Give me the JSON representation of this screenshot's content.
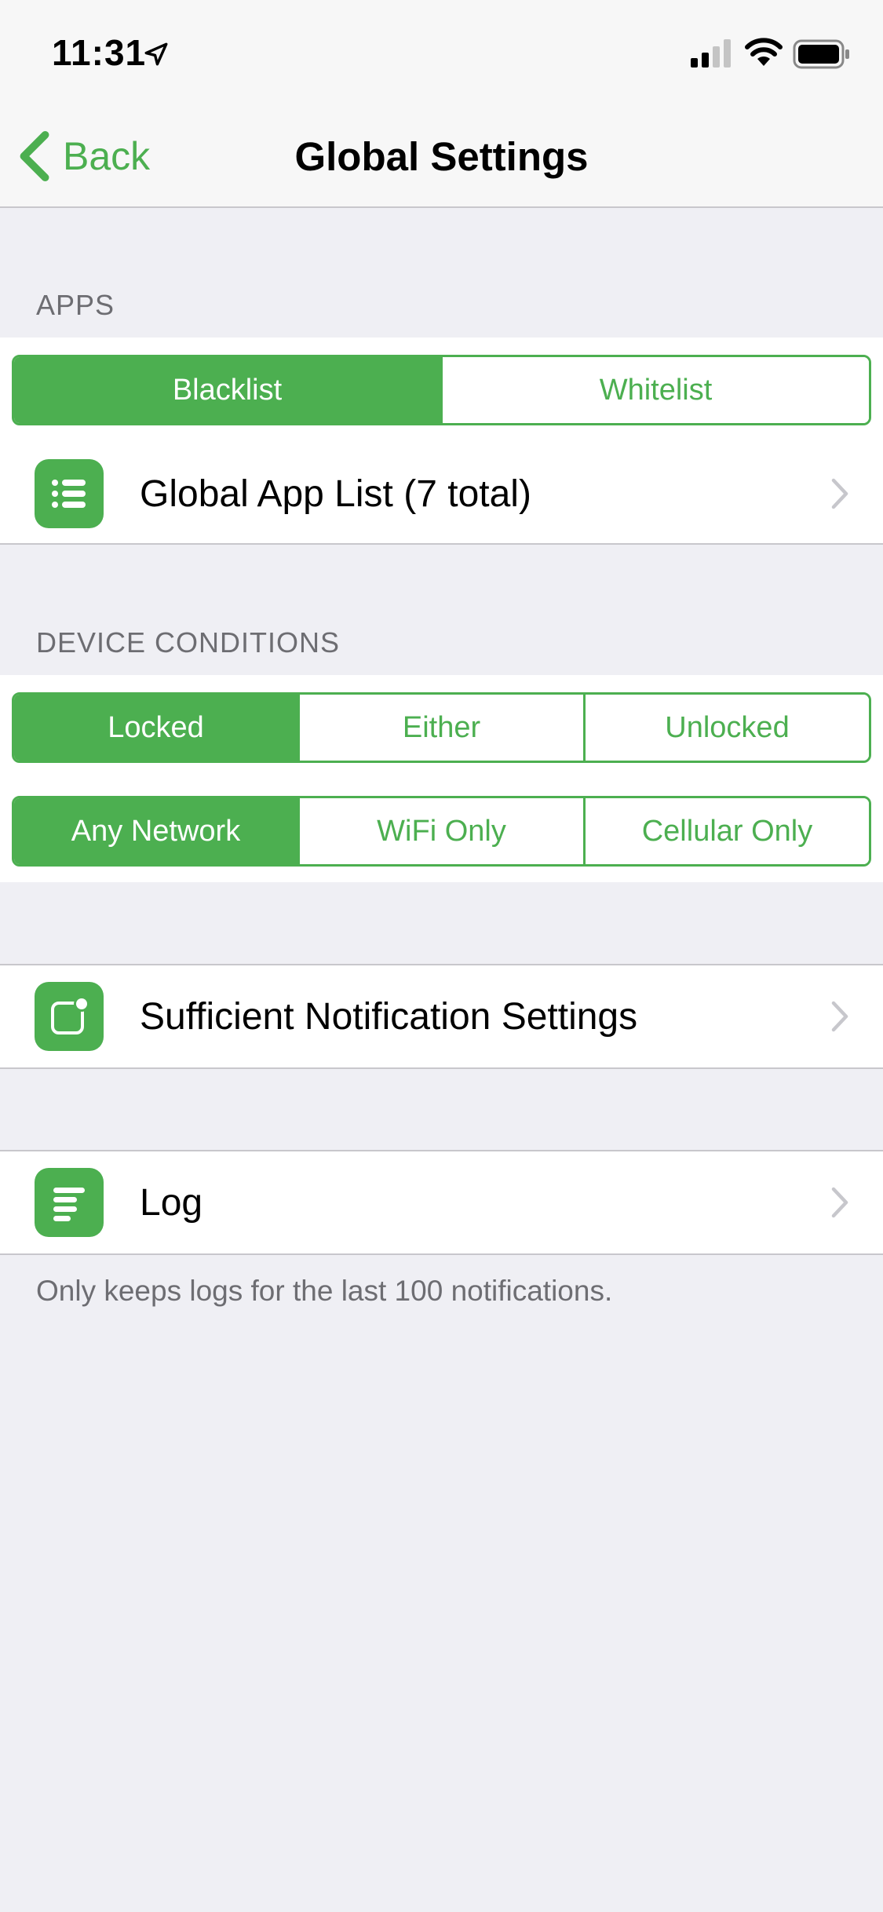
{
  "status_bar": {
    "time": "11:31",
    "icons": [
      "location-arrow-icon",
      "cellular-signal-icon",
      "wifi-icon",
      "battery-icon"
    ]
  },
  "nav": {
    "back_label": "Back",
    "title": "Global Settings"
  },
  "apps_section": {
    "header": "APPS",
    "list_mode": {
      "options": [
        "Blacklist",
        "Whitelist"
      ],
      "selected": "Blacklist"
    },
    "app_list_cell": {
      "label": "Global App List (7 total)",
      "icon": "list-icon"
    }
  },
  "device_conditions_section": {
    "header": "DEVICE CONDITIONS",
    "lock_state": {
      "options": [
        "Locked",
        "Either",
        "Unlocked"
      ],
      "selected": "Locked"
    },
    "network": {
      "options": [
        "Any Network",
        "WiFi Only",
        "Cellular Only"
      ],
      "selected": "Any Network"
    }
  },
  "notification_settings_cell": {
    "label": "Sufficient Notification Settings",
    "icon": "notification-badge-icon"
  },
  "log_cell": {
    "label": "Log",
    "icon": "log-lines-icon"
  },
  "log_footer": "Only keeps logs for the last 100 notifications.",
  "colors": {
    "accent": "#4caf50",
    "background": "#efeff4",
    "secondary_text": "#6d6d72"
  }
}
